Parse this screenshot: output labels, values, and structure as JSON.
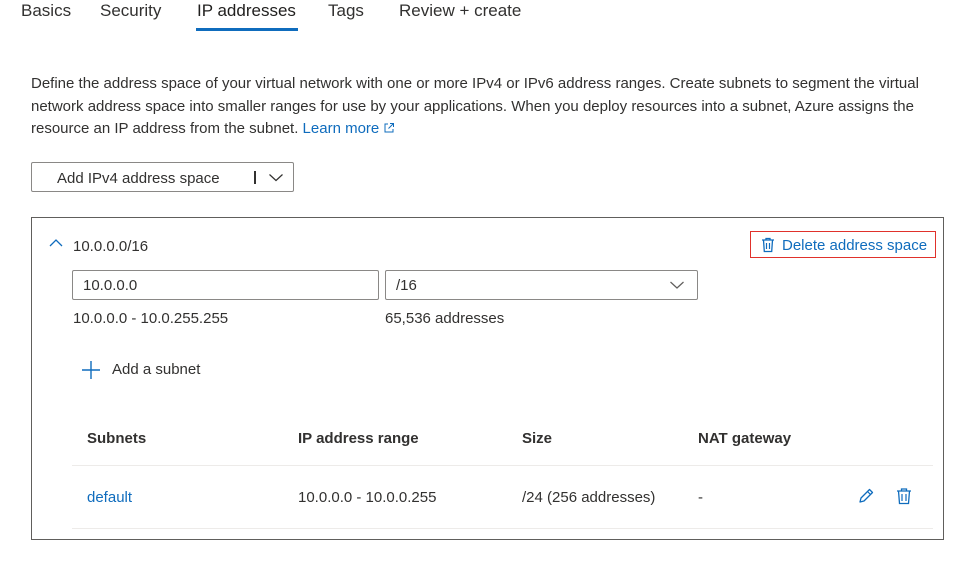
{
  "tabs": [
    {
      "label": "Basics",
      "active": false
    },
    {
      "label": "Security",
      "active": false
    },
    {
      "label": "IP addresses",
      "active": true
    },
    {
      "label": "Tags",
      "active": false
    },
    {
      "label": "Review + create",
      "active": false
    }
  ],
  "description": {
    "text": "Define the address space of your virtual network with one or more IPv4 or IPv6 address ranges. Create subnets to segment the virtual network address space into smaller ranges for use by your applications. When you deploy resources into a subnet, Azure assigns the resource an IP address from the subnet.",
    "learn_more": "Learn more"
  },
  "add_space_button": {
    "label": "Add IPv4 address space"
  },
  "address_space": {
    "title": "10.0.0.0/16",
    "delete_label": "Delete address space",
    "ip_value": "10.0.0.0",
    "prefix_value": "/16",
    "range": "10.0.0.0 - 10.0.255.255",
    "address_count": "65,536 addresses",
    "add_subnet_label": "Add a subnet"
  },
  "subnets_table": {
    "headers": [
      "Subnets",
      "IP address range",
      "Size",
      "NAT gateway"
    ],
    "rows": [
      {
        "name": "default",
        "range": "10.0.0.0 - 10.0.0.255",
        "size": "/24 (256 addresses)",
        "nat": "-"
      }
    ]
  },
  "colors": {
    "accent": "#0f6cbd",
    "highlight_border": "#e0312b",
    "text": "#323130"
  },
  "icons": [
    "external-link-icon",
    "chevron-down-icon",
    "chevron-up-icon",
    "trash-icon",
    "plus-icon",
    "edit-icon"
  ]
}
